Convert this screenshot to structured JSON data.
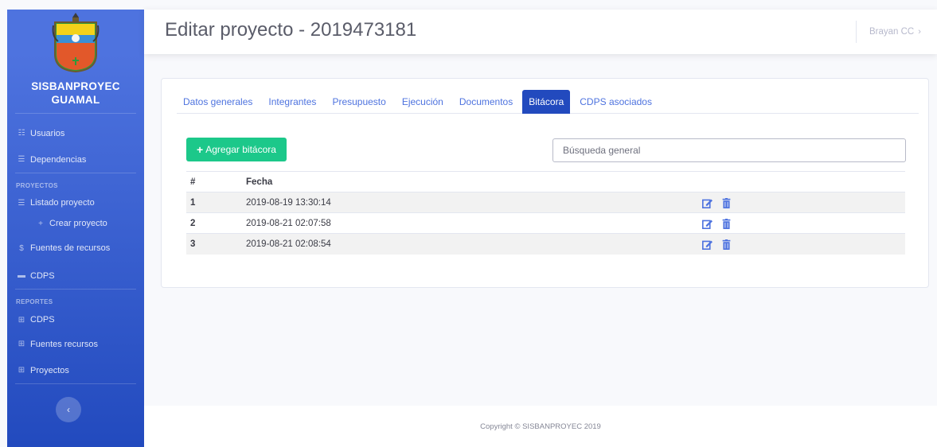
{
  "sidebar": {
    "brand_line1": "SISBANPROYEC",
    "brand_line2": "GUAMAL",
    "items": [
      {
        "label": "Usuarios",
        "icon": "users-icon"
      },
      {
        "label": "Dependencias",
        "icon": "sitemap-icon"
      }
    ],
    "heading_proyectos": "PROYECTOS",
    "proyectos_items": [
      {
        "label": "Listado proyecto",
        "icon": "list-icon"
      },
      {
        "label": "Crear proyecto",
        "icon": "plus-icon"
      },
      {
        "label": "Fuentes de recursos",
        "icon": "dollar-icon"
      },
      {
        "label": "CDPS",
        "icon": "card-icon"
      }
    ],
    "heading_reportes": "REPORTES",
    "reportes_items": [
      {
        "label": "CDPS",
        "icon": "table-icon"
      },
      {
        "label": "Fuentes recursos",
        "icon": "table-icon"
      },
      {
        "label": "Proyectos",
        "icon": "table-icon"
      }
    ],
    "toggle_glyph": "‹"
  },
  "topbar": {
    "title": "Editar proyecto - 2019473181",
    "user": "Brayan CC",
    "user_chevron": "›"
  },
  "tabs": [
    {
      "label": "Datos generales",
      "active": false
    },
    {
      "label": "Integrantes",
      "active": false
    },
    {
      "label": "Presupuesto",
      "active": false
    },
    {
      "label": "Ejecución",
      "active": false
    },
    {
      "label": "Documentos",
      "active": false
    },
    {
      "label": "Bitácora",
      "active": true
    },
    {
      "label": "CDPS asociados",
      "active": false
    }
  ],
  "toolbar": {
    "add_plus": "+",
    "add_label": "Agregar bitácora",
    "search_placeholder": "Búsqueda general"
  },
  "table": {
    "headers": [
      "#",
      "Fecha",
      ""
    ],
    "rows": [
      {
        "num": "1",
        "date": "2019-08-19 13:30:14"
      },
      {
        "num": "2",
        "date": "2019-08-21 02:07:58"
      },
      {
        "num": "3",
        "date": "2019-08-21 02:08:54"
      }
    ]
  },
  "footer": {
    "text": "Copyright © SISBANPROYEC 2019"
  },
  "colors": {
    "primary": "#4e73df",
    "primary_dark": "#224abe",
    "success": "#1cc88a"
  }
}
